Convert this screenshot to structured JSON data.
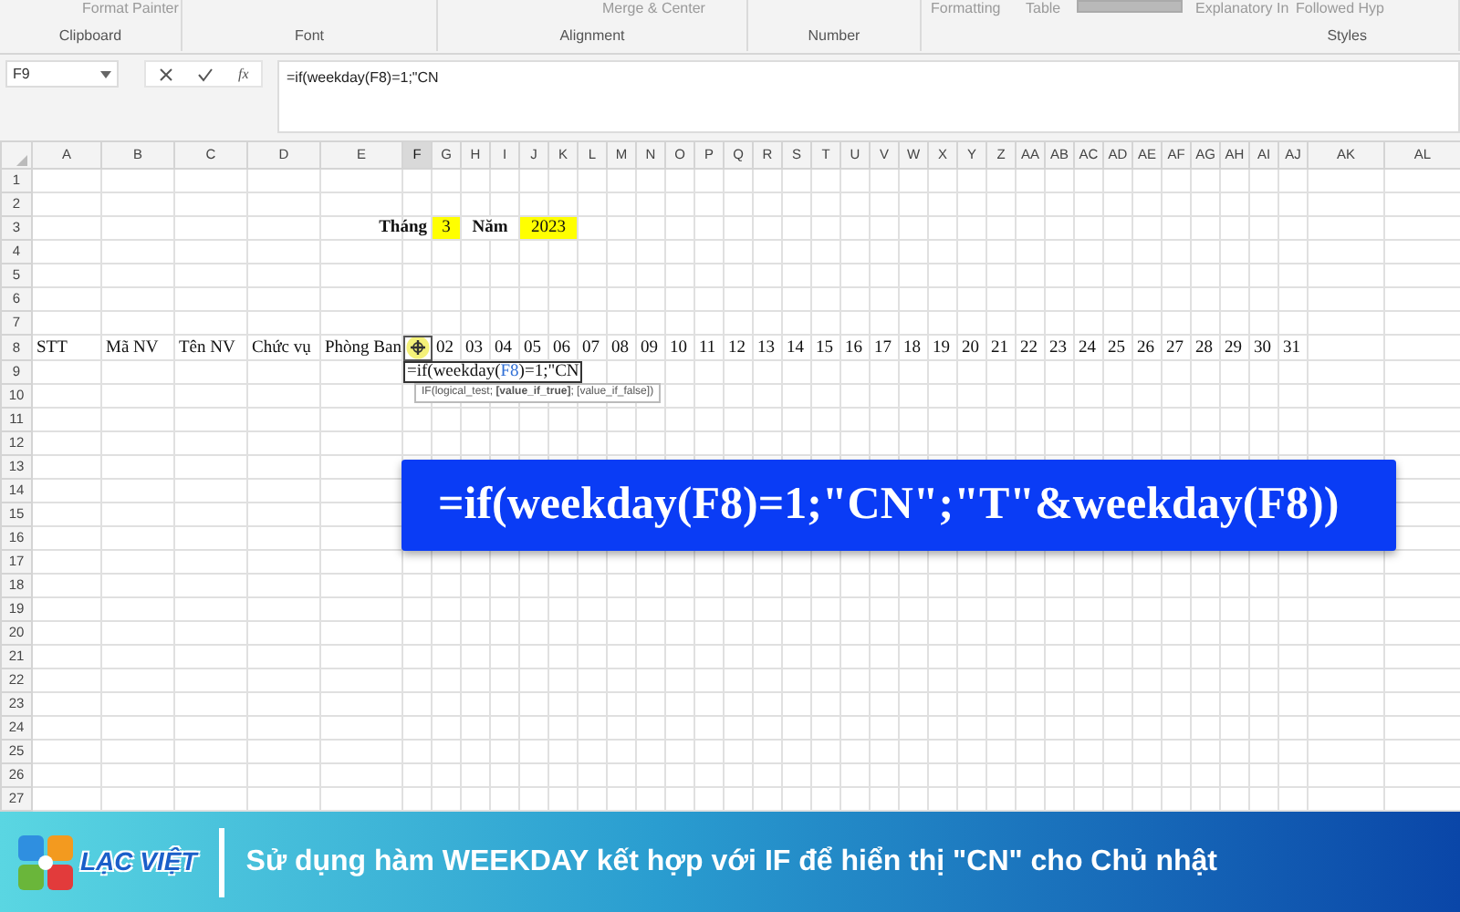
{
  "ribbon": {
    "groups": [
      {
        "label": "Clipboard",
        "fragments": [
          "Format Painter"
        ]
      },
      {
        "label": "Font"
      },
      {
        "label": "Alignment",
        "fragments": [
          "Merge & Center"
        ]
      },
      {
        "label": "Number"
      },
      {
        "label": "Styles",
        "fragments": [
          "Formatting",
          "Table",
          "Explanatory In",
          "Followed Hyp"
        ]
      }
    ]
  },
  "formula_bar": {
    "name_box": "F9",
    "function_label": "fx",
    "formula": "=if(weekday(F8)=1;\"CN"
  },
  "sheet": {
    "columns": [
      {
        "label": "A",
        "selected": false
      },
      {
        "label": "B",
        "selected": false
      },
      {
        "label": "C",
        "selected": false
      },
      {
        "label": "D",
        "selected": false
      },
      {
        "label": "E",
        "selected": false
      },
      {
        "label": "F",
        "selected": true
      },
      {
        "label": "G",
        "selected": false
      },
      {
        "label": "H",
        "selected": false
      },
      {
        "label": "I",
        "selected": false
      },
      {
        "label": "J",
        "selected": false
      },
      {
        "label": "K",
        "selected": false
      },
      {
        "label": "L",
        "selected": false
      },
      {
        "label": "M",
        "selected": false
      },
      {
        "label": "N",
        "selected": false
      },
      {
        "label": "O",
        "selected": false
      },
      {
        "label": "P",
        "selected": false
      },
      {
        "label": "Q",
        "selected": false
      },
      {
        "label": "R",
        "selected": false
      },
      {
        "label": "S",
        "selected": false
      },
      {
        "label": "T",
        "selected": false
      },
      {
        "label": "U",
        "selected": false
      },
      {
        "label": "V",
        "selected": false
      },
      {
        "label": "W",
        "selected": false
      },
      {
        "label": "X",
        "selected": false
      },
      {
        "label": "Y",
        "selected": false
      },
      {
        "label": "Z",
        "selected": false
      },
      {
        "label": "AA",
        "selected": false
      },
      {
        "label": "AB",
        "selected": false
      },
      {
        "label": "AC",
        "selected": false
      },
      {
        "label": "AD",
        "selected": false
      },
      {
        "label": "AE",
        "selected": false
      },
      {
        "label": "AF",
        "selected": false
      },
      {
        "label": "AG",
        "selected": false
      },
      {
        "label": "AH",
        "selected": false
      },
      {
        "label": "AI",
        "selected": false
      },
      {
        "label": "AJ",
        "selected": false
      },
      {
        "label": "AK",
        "selected": false
      },
      {
        "label": "AL",
        "selected": false
      }
    ],
    "rows": [
      {
        "number": "1"
      },
      {
        "number": "2"
      },
      {
        "number": "3",
        "cells": [
          null,
          null,
          null,
          null,
          null,
          {
            "text": "Tháng",
            "kind": "label"
          },
          {
            "text": "3",
            "kind": "input"
          },
          {
            "text": "Năm",
            "kind": "label",
            "merged": true
          },
          {
            "text": "2023",
            "kind": "input",
            "merged": true
          }
        ]
      },
      {
        "number": "4"
      },
      {
        "number": "5"
      },
      {
        "number": "6"
      },
      {
        "number": "7"
      },
      {
        "number": "8",
        "cells": [
          {
            "text": "STT"
          },
          {
            "text": "Mã NV"
          },
          {
            "text": "Tên NV"
          },
          {
            "text": "Chức vụ"
          },
          {
            "text": "Phòng Ban"
          },
          {
            "kind": "referenced"
          },
          {
            "text": "02"
          },
          {
            "text": "03"
          },
          {
            "text": "04"
          },
          {
            "text": "05"
          },
          {
            "text": "06"
          },
          {
            "text": "07"
          },
          {
            "text": "08"
          },
          {
            "text": "09"
          },
          {
            "text": "10"
          },
          {
            "text": "11"
          },
          {
            "text": "12"
          },
          {
            "text": "13"
          },
          {
            "text": "14"
          },
          {
            "text": "15"
          },
          {
            "text": "16"
          },
          {
            "text": "17"
          },
          {
            "text": "18"
          },
          {
            "text": "19"
          },
          {
            "text": "20"
          },
          {
            "text": "21"
          },
          {
            "text": "22"
          },
          {
            "text": "23"
          },
          {
            "text": "24"
          },
          {
            "text": "25"
          },
          {
            "text": "26"
          },
          {
            "text": "27"
          },
          {
            "text": "28"
          },
          {
            "text": "29"
          },
          {
            "text": "30"
          },
          {
            "text": "31"
          }
        ]
      },
      {
        "number": "9",
        "cells": [
          null,
          null,
          null,
          null,
          null,
          {
            "kind": "editing",
            "segments": [
              {
                "text": "=if(weekday("
              },
              {
                "text": "F8",
                "kind": "ref"
              },
              {
                "text": ")=1;\"CN"
              }
            ]
          }
        ]
      },
      {
        "number": "10"
      },
      {
        "number": "11"
      },
      {
        "number": "12"
      },
      {
        "number": "13"
      },
      {
        "number": "14"
      },
      {
        "number": "15"
      },
      {
        "number": "16"
      },
      {
        "number": "17"
      },
      {
        "number": "18"
      },
      {
        "number": "19"
      },
      {
        "number": "20"
      },
      {
        "number": "21"
      },
      {
        "number": "22"
      },
      {
        "number": "23"
      },
      {
        "number": "24"
      },
      {
        "number": "25"
      },
      {
        "number": "26"
      },
      {
        "number": "27"
      }
    ],
    "tooltip": "IF(logical_test; **[value_if_true]**; [value_if_false])"
  },
  "callout": {
    "text": "=if(weekday(F8)=1;\"CN\";\"T\"&weekday(F8))"
  },
  "banner": {
    "brand": "LẠC VIỆT",
    "caption": "Sử dụng hàm WEEKDAY kết hợp với IF để hiển thị \"CN\" cho Chủ nhật"
  }
}
